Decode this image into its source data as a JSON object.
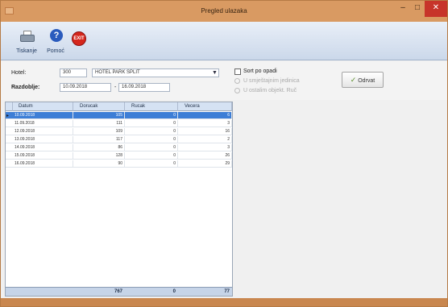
{
  "window": {
    "title": "Pregled ulazaka",
    "minimize": "–",
    "maximize": "□",
    "close": "✕"
  },
  "toolbar": {
    "print_label": "Tiskanje",
    "help_label": "Pomoć",
    "help_glyph": "?",
    "exit_glyph": "EXIT"
  },
  "filter": {
    "hotel_label": "Hotel:",
    "hotel_code": "300",
    "hotel_name": "HOTEL PARK SPLIT",
    "period_label": "Razdoblje:",
    "date_from": "10.09.2018",
    "date_to": "16.09.2018",
    "date_sep": "-",
    "sort_label": "Sort po opadi",
    "radio1": "U smještajnim jedinica",
    "radio2": "U ostalim objekt. Ruč",
    "filter_button": "Odrvat"
  },
  "grid": {
    "columns": [
      "Datum",
      "Dorucak",
      "Rucak",
      "Vecera"
    ],
    "rows": [
      {
        "datum": "10.09.2018",
        "dorucak": "105",
        "rucak": "0",
        "vecera": "6"
      },
      {
        "datum": "11.09.2018",
        "dorucak": "111",
        "rucak": "0",
        "vecera": "3"
      },
      {
        "datum": "12.09.2018",
        "dorucak": "109",
        "rucak": "0",
        "vecera": "16"
      },
      {
        "datum": "13.09.2018",
        "dorucak": "117",
        "rucak": "0",
        "vecera": "2"
      },
      {
        "datum": "14.09.2018",
        "dorucak": "86",
        "rucak": "0",
        "vecera": "3"
      },
      {
        "datum": "15.09.2018",
        "dorucak": "128",
        "rucak": "0",
        "vecera": "26"
      },
      {
        "datum": "16.09.2018",
        "dorucak": "90",
        "rucak": "0",
        "vecera": "29"
      }
    ],
    "totals": {
      "dorucak": "767",
      "rucak": "0",
      "vecera": "77"
    }
  },
  "colors": {
    "titlebar": "#d99a62",
    "selection": "#3d7ed6",
    "close": "#c7342a"
  },
  "icons": {
    "print": "printer-icon",
    "help": "help-icon",
    "exit": "exit-icon"
  }
}
